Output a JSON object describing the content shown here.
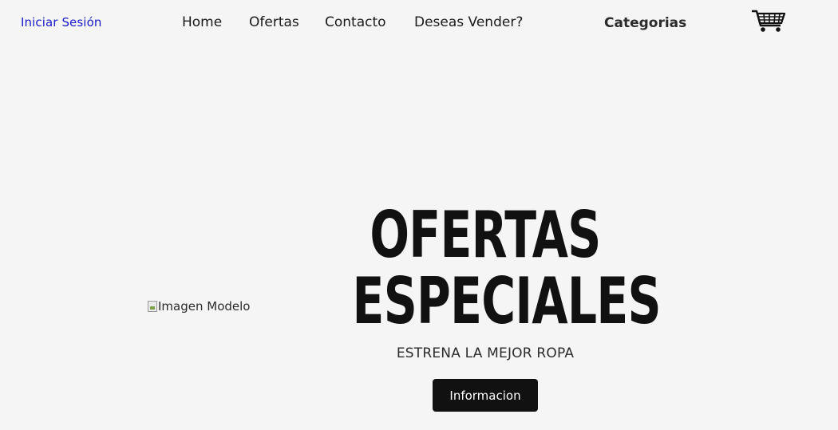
{
  "header": {
    "login_label": "Iniciar Sesión",
    "nav": [
      {
        "label": "Home"
      },
      {
        "label": "Ofertas"
      },
      {
        "label": "Contacto"
      },
      {
        "label": "Deseas Vender?"
      }
    ],
    "categories_label": "Categorias",
    "cart_icon": "shopping-cart-icon"
  },
  "hero": {
    "image_alt": "Imagen Modelo",
    "title_line1": "OFERTAS",
    "title_line2": "ESPECIALES",
    "subtitle": "ESTRENA LA MEJOR ROPA",
    "button_label": "Informacion"
  },
  "colors": {
    "background": "#f5f5f5",
    "login_link": "#1a1acc",
    "text": "#1a1a1a",
    "button_bg": "#111111",
    "button_text": "#ffffff"
  }
}
